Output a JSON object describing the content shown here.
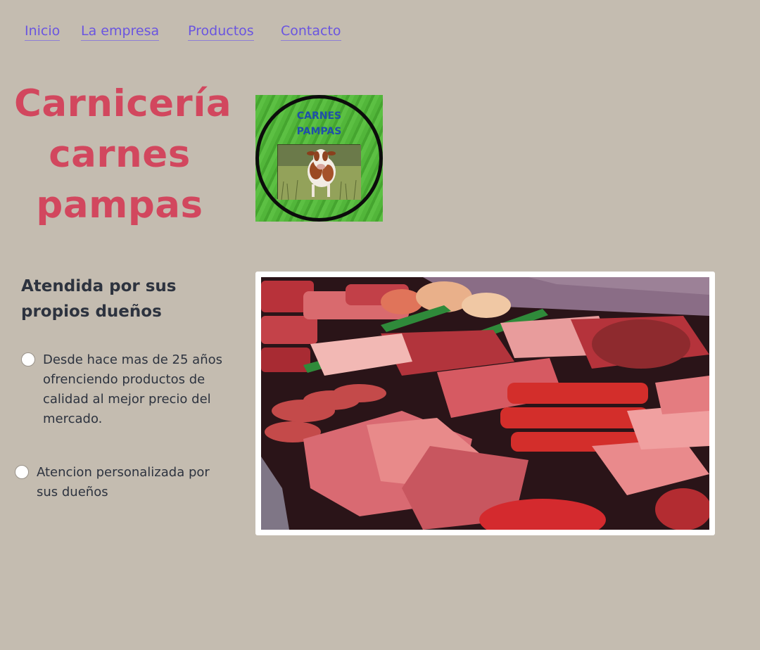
{
  "nav": {
    "items": [
      {
        "label": "Inicio"
      },
      {
        "label": "La empresa"
      },
      {
        "label": "Productos"
      },
      {
        "label": "Contacto"
      }
    ]
  },
  "header": {
    "title": "Carnicería carnes pampas",
    "title_lines": [
      "Carnicería",
      "carnes",
      "pampas"
    ]
  },
  "logo": {
    "line1": "CARNES",
    "line2": "PAMPAS",
    "icon": "cow-icon"
  },
  "main": {
    "subtitle": "Atendida por sus propios dueños",
    "bullets": [
      "Desde hace mas de 25 años ofrenciendo productos de calidad al mejor precio del mercado.",
      "Atencion personalizada por sus dueños"
    ],
    "photo_icon": "meat-display-image"
  },
  "colors": {
    "background": "#c4bcb0",
    "link": "#6a55e0",
    "title": "#d2475e",
    "text": "#2d333f"
  }
}
